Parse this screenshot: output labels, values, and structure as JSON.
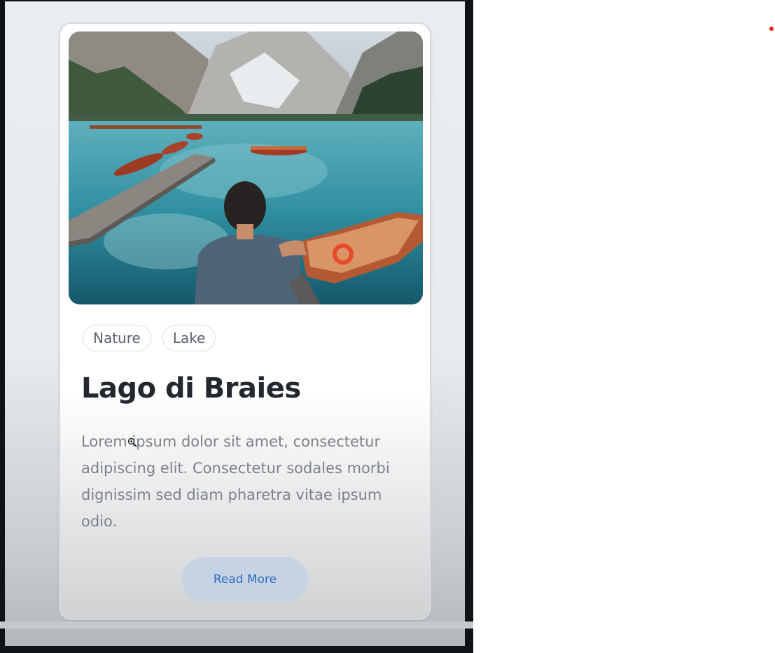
{
  "card": {
    "image_alt": "Man sitting on dock overlooking alpine lake with wooden rowboats",
    "tags": [
      "Nature",
      "Lake"
    ],
    "title": "Lago di Braies",
    "description": "Lorem ipsum dolor sit amet, consectetur adipiscing elit. Consectetur sodales morbi dignissim sed diam pharetra vitae ipsum odio.",
    "button_label": "Read More"
  },
  "icons": {
    "cursor": "zoom-in-cursor-icon",
    "indicator": "red-dot-indicator"
  },
  "colors": {
    "frame": "#0f1216",
    "button_bg": "#c5d3e4",
    "button_text": "#2f6bbf",
    "title": "#23282e",
    "body_text": "#7d8287"
  }
}
